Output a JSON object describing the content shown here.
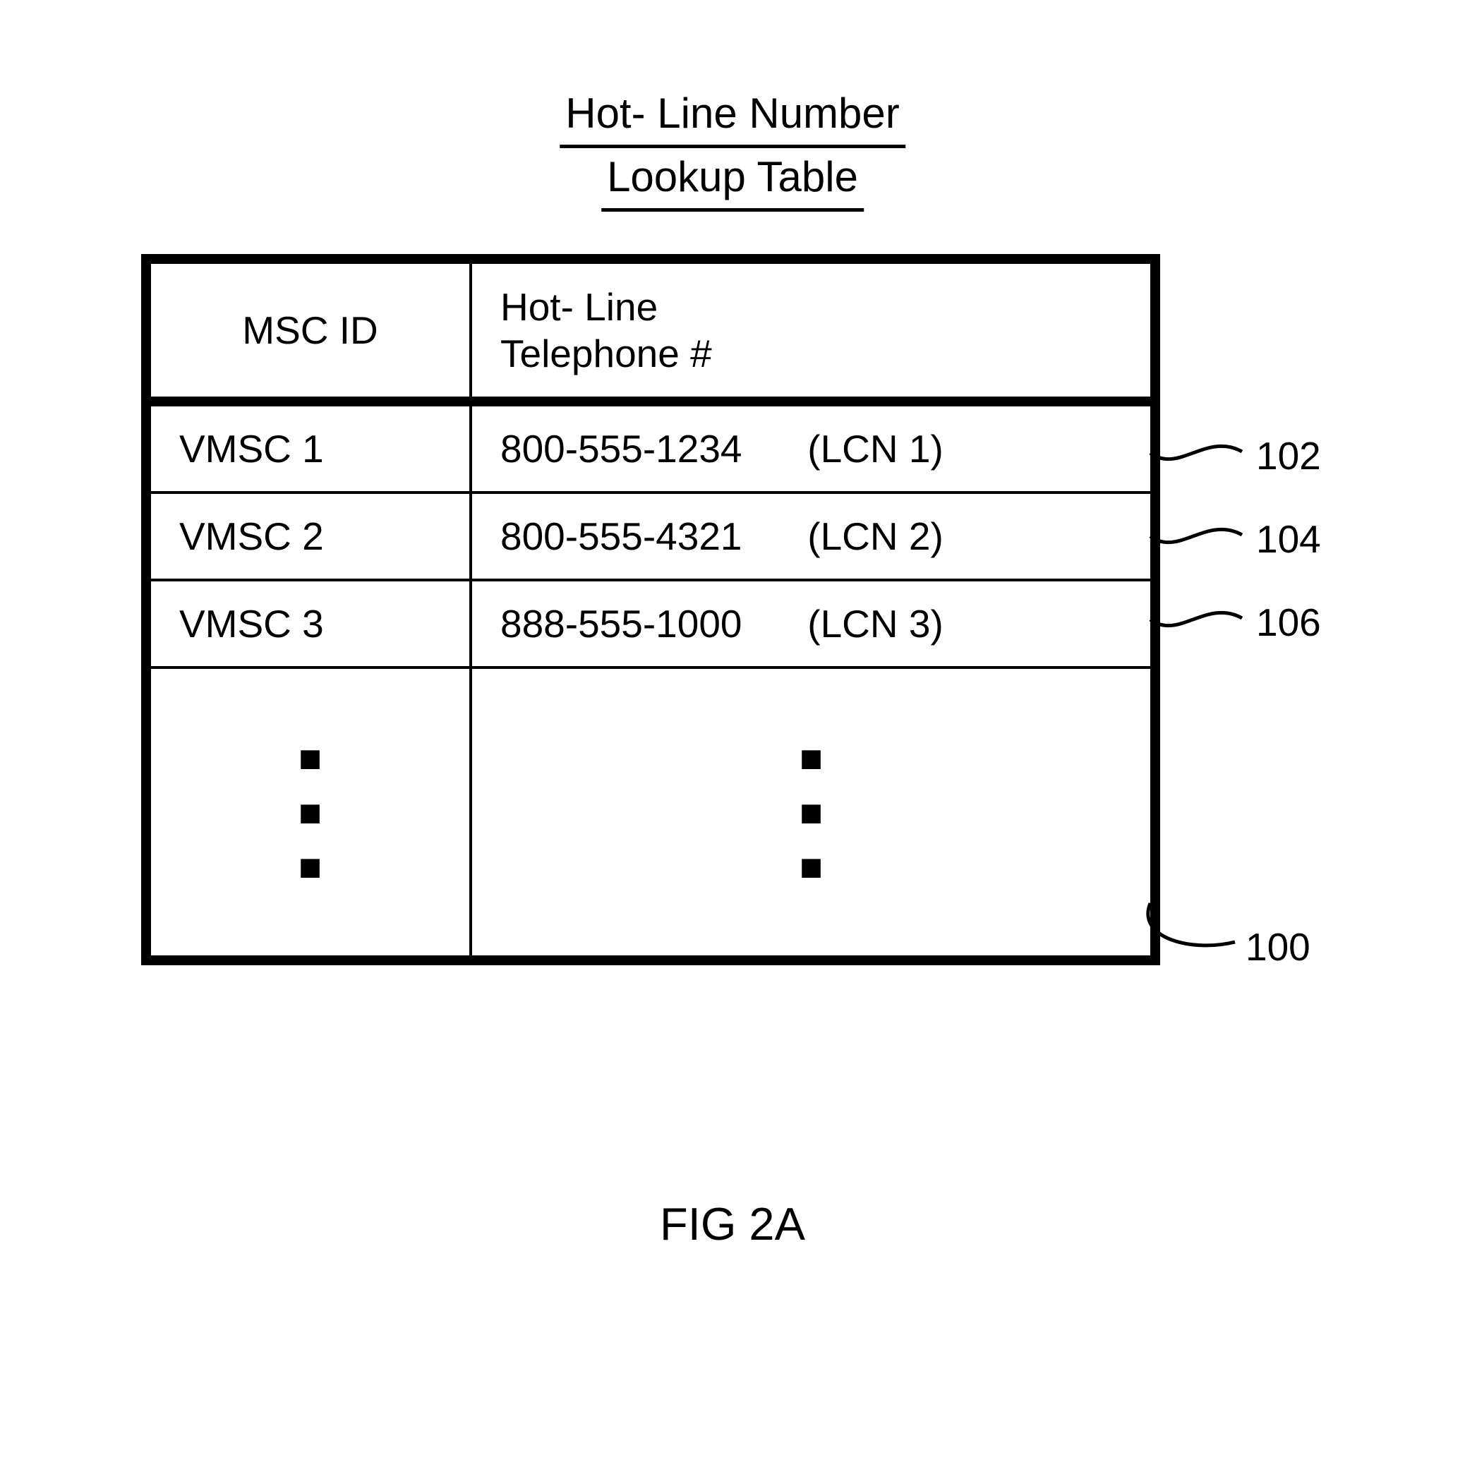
{
  "title": {
    "line1": "Hot- Line Number",
    "line2": "Lookup Table"
  },
  "headers": {
    "col1": "MSC ID",
    "col2_l1": "Hot- Line",
    "col2_l2": "Telephone #"
  },
  "rows": [
    {
      "msc": "VMSC 1",
      "phone": "800-555-1234",
      "lcn": "(LCN 1)",
      "ref": "102"
    },
    {
      "msc": "VMSC 2",
      "phone": "800-555-4321",
      "lcn": "(LCN 2)",
      "ref": "104"
    },
    {
      "msc": "VMSC 3",
      "phone": "888-555-1000",
      "lcn": "(LCN 3)",
      "ref": "106"
    }
  ],
  "table_ref": "100",
  "figure_label": "FIG 2A",
  "dot": "■"
}
